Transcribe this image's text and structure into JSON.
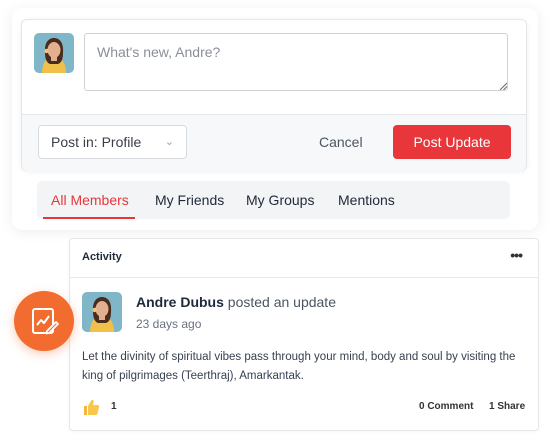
{
  "composer": {
    "placeholder": "What's new, Andre?",
    "post_in_label": "Post in: Profile",
    "cancel_label": "Cancel",
    "submit_label": "Post Update"
  },
  "tabs": [
    {
      "label": "All Members",
      "active": true
    },
    {
      "label": "My Friends",
      "active": false
    },
    {
      "label": "My Groups",
      "active": false
    },
    {
      "label": "Mentions",
      "active": false
    }
  ],
  "activity": {
    "title": "Activity",
    "post": {
      "author": "Andre Dubus",
      "action": "posted an update",
      "time": "23 days ago",
      "body": "Let the divinity of spiritual vibes pass through your mind, body and soul by visiting the king of pilgrimages (Teerthraj), Amarkantak.",
      "like_count": "1",
      "comments_label": "0 Comment",
      "share_label": "1 Share"
    }
  },
  "icons": {
    "fab": "activity-edit-icon",
    "more": "more-options-icon",
    "like": "thumbs-up-icon",
    "chevron": "chevron-down-icon"
  },
  "colors": {
    "accent": "#e8363a",
    "fab": "#f26b2f",
    "avatar_bg": "#7fb6c8"
  }
}
